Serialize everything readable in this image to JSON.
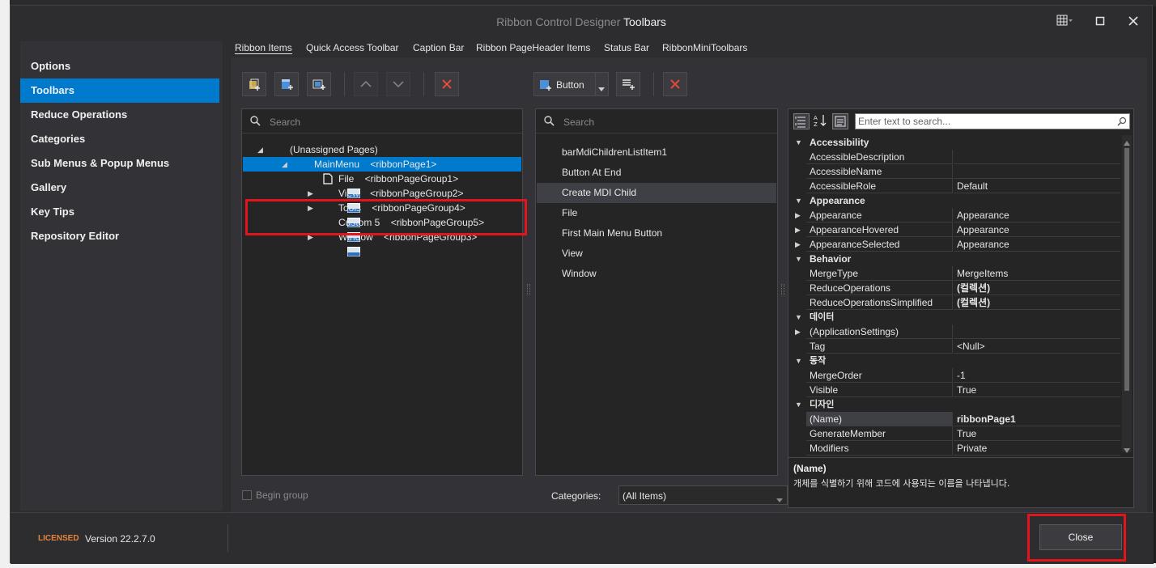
{
  "window": {
    "title_prefix": "Ribbon Control Designer",
    "title_main": "Toolbars"
  },
  "sidebar": {
    "items": [
      {
        "label": "Options"
      },
      {
        "label": "Toolbars"
      },
      {
        "label": "Reduce Operations"
      },
      {
        "label": "Categories"
      },
      {
        "label": "Sub Menus & Popup Menus"
      },
      {
        "label": "Gallery"
      },
      {
        "label": "Key Tips"
      },
      {
        "label": "Repository Editor"
      }
    ],
    "active_index": 1
  },
  "tabs": [
    {
      "label": "Ribbon Items"
    },
    {
      "label": "Quick Access Toolbar"
    },
    {
      "label": "Caption Bar"
    },
    {
      "label": "Ribbon PageHeader Items"
    },
    {
      "label": "Status Bar"
    },
    {
      "label": "RibbonMiniToolbars"
    }
  ],
  "toolbar": {
    "item_type": "Button"
  },
  "tree": {
    "search_placeholder": "Search",
    "rows": [
      {
        "text": "(Unassigned Pages)"
      },
      {
        "text": "MainMenu    <ribbonPage1>"
      },
      {
        "text": "File    <ribbonPageGroup1>"
      },
      {
        "text": "View    <ribbonPageGroup2>"
      },
      {
        "text": "Tools    <ribbonPageGroup4>"
      },
      {
        "text": "Custom 5    <ribbonPageGroup5>"
      },
      {
        "text": "Window    <ribbonPageGroup3>"
      }
    ],
    "begin_group_label": "Begin group"
  },
  "items_list": {
    "search_placeholder": "Search",
    "rows": [
      {
        "text": "barMdiChildrenListItem1"
      },
      {
        "text": "Button At End"
      },
      {
        "text": "Create MDI Child"
      },
      {
        "text": "File"
      },
      {
        "text": "First Main Menu Button"
      },
      {
        "text": "View"
      },
      {
        "text": "Window"
      }
    ],
    "categories_label": "Categories:",
    "categories_value": "(All Items)"
  },
  "property_grid": {
    "search_placeholder": "Enter text to search...",
    "rows": [
      {
        "name": "Accessibility",
        "value": ""
      },
      {
        "name": "AccessibleDescription",
        "value": ""
      },
      {
        "name": "AccessibleName",
        "value": ""
      },
      {
        "name": "AccessibleRole",
        "value": "Default"
      },
      {
        "name": "Appearance",
        "value": ""
      },
      {
        "name": "Appearance",
        "value": "Appearance"
      },
      {
        "name": "AppearanceHovered",
        "value": "Appearance"
      },
      {
        "name": "AppearanceSelected",
        "value": "Appearance"
      },
      {
        "name": "Behavior",
        "value": ""
      },
      {
        "name": "MergeType",
        "value": "MergeItems"
      },
      {
        "name": "ReduceOperations",
        "value": "(컬렉션)"
      },
      {
        "name": "ReduceOperationsSimplified",
        "value": "(컬렉션)"
      },
      {
        "name": "데이터",
        "value": ""
      },
      {
        "name": "(ApplicationSettings)",
        "value": ""
      },
      {
        "name": "Tag",
        "value": "<Null>"
      },
      {
        "name": "동작",
        "value": ""
      },
      {
        "name": "MergeOrder",
        "value": "-1"
      },
      {
        "name": "Visible",
        "value": "True"
      },
      {
        "name": "디자인",
        "value": ""
      },
      {
        "name": "(Name)",
        "value": "ribbonPage1"
      },
      {
        "name": "GenerateMember",
        "value": "True"
      },
      {
        "name": "Modifiers",
        "value": "Private"
      }
    ],
    "description_title": "(Name)",
    "description_text": "개체를 식별하기 위해 코드에 사용되는 이름을 나타냅니다."
  },
  "footer": {
    "licensed": "LICENSED",
    "version": "Version 22.2.7.0",
    "close_label": "Close"
  },
  "colors": {
    "accent": "#007acc",
    "highlight_box": "#e3151c",
    "licensed": "#e6843a"
  }
}
